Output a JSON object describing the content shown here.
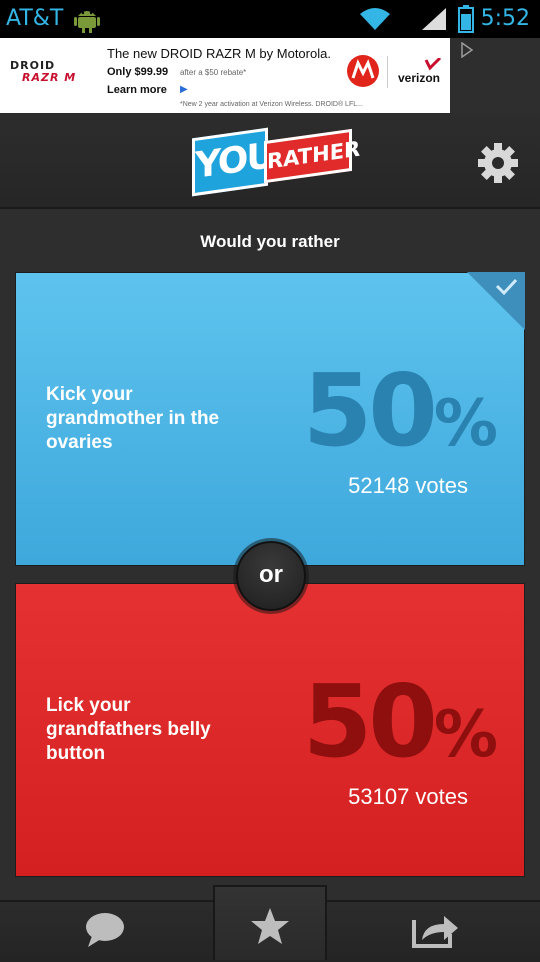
{
  "status_bar": {
    "carrier": "AT&T",
    "time": "5:52",
    "icons": [
      "android-icon",
      "wifi-icon",
      "signal-icon",
      "battery-icon"
    ]
  },
  "ad": {
    "brand_line1": "DROID",
    "brand_line2": "RAZR M",
    "headline": "The new DROID RAZR M by Motorola.",
    "price": "Only $99.99",
    "rebate": "after a $50 rebate*",
    "cta": "Learn more",
    "fine_print": "*New 2 year activation at Verizon Wireless.  DROID® LFL...",
    "verizon_text": "verizon"
  },
  "header": {
    "logo_you": "YOU",
    "logo_rather": "RATHER"
  },
  "question": {
    "prompt": "Would you rather",
    "separator": "or",
    "option_a": {
      "text": "Kick your grandmother in the ovaries",
      "percent_value": "50",
      "percent_symbol": "%",
      "votes": "52148 votes",
      "selected": true
    },
    "option_b": {
      "text": "Lick your grandfathers belly button",
      "percent_value": "50",
      "percent_symbol": "%",
      "votes": "53107 votes",
      "selected": false
    }
  },
  "colors": {
    "option_a_bg": "#4fb8e8",
    "option_b_bg": "#dd2a2a",
    "accent": "#33b5e5"
  },
  "bottom_nav": [
    "comment-icon",
    "star-icon",
    "share-icon"
  ]
}
